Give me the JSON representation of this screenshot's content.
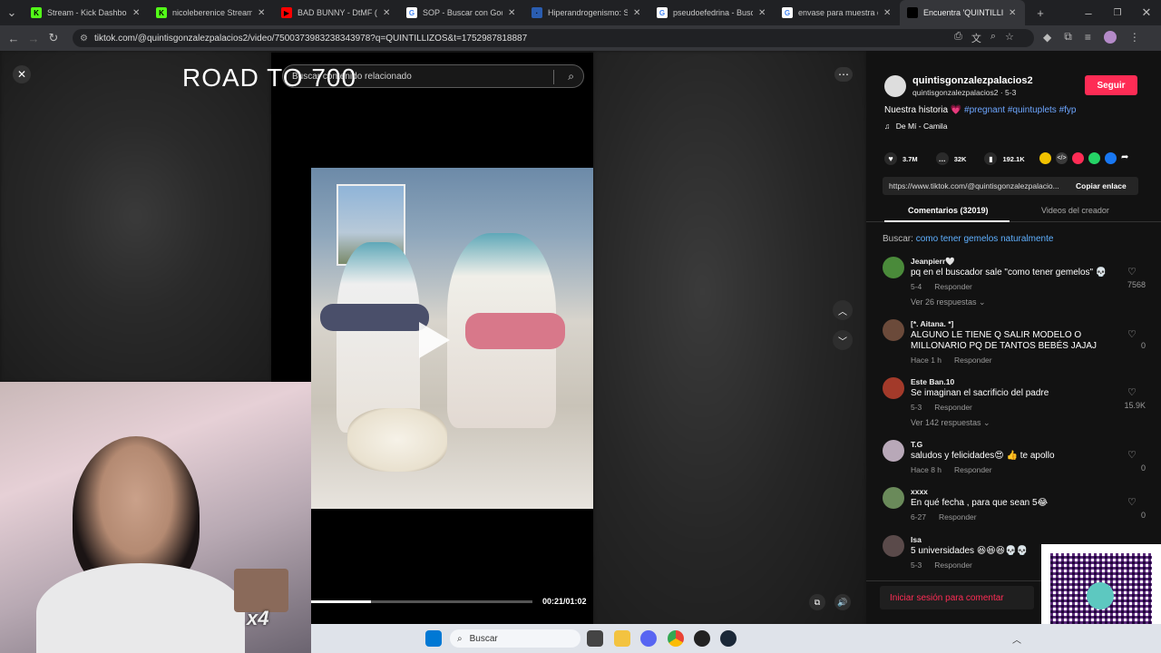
{
  "tabs": [
    {
      "title": "Stream - Kick Dashboard",
      "favicon_color": "#53fc18",
      "favicon_glyph": "K"
    },
    {
      "title": "nicoleberenice Stream - V",
      "favicon_color": "#53fc18",
      "favicon_glyph": "K"
    },
    {
      "title": "BAD BUNNY - DtMF (Visu",
      "favicon_color": "#ff0000",
      "favicon_glyph": "▶"
    },
    {
      "title": "SOP - Buscar con Google",
      "favicon_color": "#ffffff",
      "favicon_glyph": "G"
    },
    {
      "title": "Hiperandrogenismo: SOP",
      "favicon_color": "#2a5db0",
      "favicon_glyph": "·"
    },
    {
      "title": "pseudoefedrina - Buscar",
      "favicon_color": "#ffffff",
      "favicon_glyph": "G"
    },
    {
      "title": "envase para muestra de o",
      "favicon_color": "#ffffff",
      "favicon_glyph": "G"
    },
    {
      "title": "Encuentra 'QUINTILLIZOS",
      "favicon_color": "#000000",
      "favicon_glyph": "♪",
      "active": true
    }
  ],
  "url": "tiktok.com/@quintisgonzalezpalacios2/video/7500373983238343978?q=QUINTILLIZOS&t=1752987818887",
  "overlay_title": "ROAD TO 700",
  "video": {
    "search_placeholder": "Buscar contenido relacionado",
    "time": "00:21/01:02",
    "progress": 0.27
  },
  "creator": {
    "username": "quintisgonzalezpalacios2",
    "subline": "quintisgonzalezpalacios2 · 5-3",
    "follow_label": "Seguir",
    "caption_text": "Nuestra historia",
    "caption_emoji": "💗",
    "hashtags": "#pregnant #quintuplets #fyp",
    "music": "De Mí - Camila"
  },
  "actions": {
    "likes": "3.7M",
    "comments": "32K",
    "saves": "192.1K"
  },
  "link": {
    "url": "https://www.tiktok.com/@quintisgonzalezpalacio...",
    "copy_label": "Copiar enlace"
  },
  "panel_tabs": {
    "comments": "Comentarios (32019)",
    "creator_videos": "Videos del creador"
  },
  "search_suggest": {
    "prefix": "Buscar:",
    "query": "como tener gemelos naturalmente"
  },
  "comments": [
    {
      "name": "Jeanpierr🤍",
      "text": "pq en el buscador sale \"como tener gemelos\" 💀",
      "date": "5-4",
      "reply": "Responder",
      "likes": "7568",
      "view_replies": "Ver 26 respuestas ⌄",
      "avatar": "#4a8a3a"
    },
    {
      "name": "[*. Aitana. *]",
      "text": "ALGUNO LE TIENE Q SALIR MODELO O MILLONARIO PQ DE TANTOS BEBÉS JAJAJ",
      "date": "Hace 1 h",
      "reply": "Responder",
      "likes": "0",
      "view_replies": "",
      "avatar": "#6b4a3a"
    },
    {
      "name": "Este Ban.10",
      "text": "Se imaginan el sacrificio del padre",
      "date": "5-3",
      "reply": "Responder",
      "likes": "15.9K",
      "view_replies": "Ver 142 respuestas ⌄",
      "avatar": "#a33a2a"
    },
    {
      "name": "T.G",
      "text": "saludos y felicidades😍 👍 te apollo",
      "date": "Hace 8 h",
      "reply": "Responder",
      "likes": "0",
      "view_replies": "",
      "avatar": "#b8a8b8"
    },
    {
      "name": "xxxx",
      "text": "En qué fecha , para que sean 5😂",
      "date": "6-27",
      "reply": "Responder",
      "likes": "0",
      "view_replies": "",
      "avatar": "#6a8a5a"
    },
    {
      "name": "Isa",
      "text": "5 universidades 😆😆😆💀💀",
      "date": "5-3",
      "reply": "Responder",
      "likes": "",
      "view_replies": "",
      "avatar": "#5a4a4a"
    }
  ],
  "login_prompt": "Iniciar sesión para comentar",
  "webcam_counter": "x4",
  "taskbar": {
    "search_label": "Buscar"
  },
  "colors": {
    "accent": "#fe2c55",
    "hashtag": "#6da6ff",
    "link": "#5fb0ff"
  }
}
